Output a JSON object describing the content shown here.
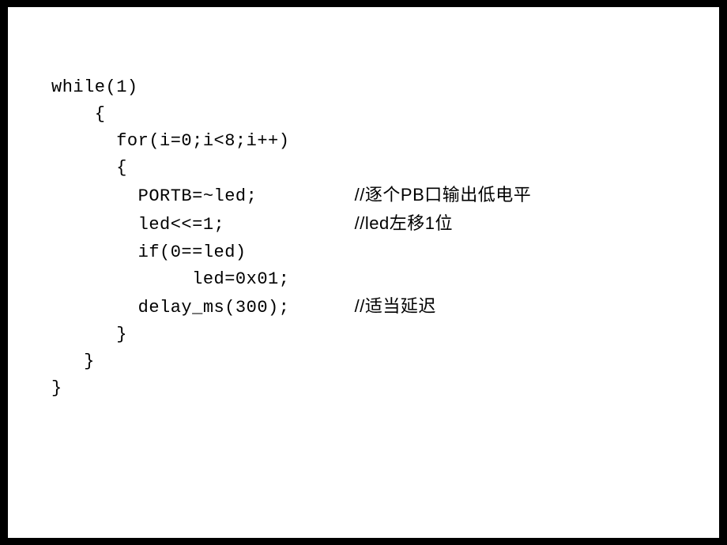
{
  "code": {
    "line1": "while(1)",
    "line2": "    {",
    "line3": "      for(i=0;i<8;i++)",
    "line4": "      {",
    "line5_code": "        PORTB=~led;",
    "line5_comment": "//逐个PB口输出低电平",
    "line6_code": "        led<<=1;",
    "line6_comment": "//led左移1位",
    "line7": "        if(0==led)",
    "line8": "             led=0x01;",
    "line9_code": "        delay_ms(300);",
    "line9_comment": "//适当延迟",
    "line10": "      }",
    "line11": "   }",
    "line12": "}"
  }
}
